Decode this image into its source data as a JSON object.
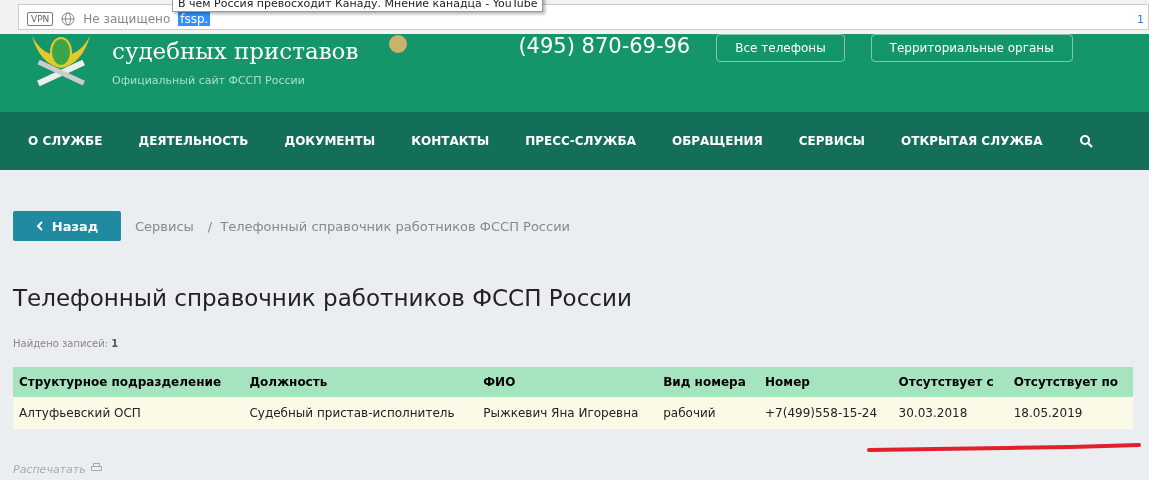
{
  "browser_bar": {
    "vpn_badge": "VPN",
    "security": "Не защищено",
    "url": "fssp.",
    "tooltip": "В чем Россия превосходит Канаду. Мнение канадца - YouTube",
    "counter": "1"
  },
  "header": {
    "title": "судебных приставов",
    "subtitle": "Официальный сайт ФССП России",
    "phone": "(495) 870-69-96",
    "buttons": [
      "Все телефоны",
      "Территориальные органы"
    ]
  },
  "nav": {
    "items": [
      "О СЛУЖБЕ",
      "ДЕЯТЕЛЬНОСТЬ",
      "ДОКУМЕНТЫ",
      "КОНТАКТЫ",
      "ПРЕСС-СЛУЖБА",
      "ОБРАЩЕНИЯ",
      "СЕРВИСЫ",
      "ОТКРЫТАЯ СЛУЖБА"
    ]
  },
  "back_button": "Назад",
  "breadcrumbs": [
    "Сервисы",
    "Телефонный справочник работников ФССП России"
  ],
  "breadcrumb_separator": "/",
  "page_title": "Телефонный справочник работников ФССП России",
  "found": {
    "label": "Найдено записей:",
    "count": "1"
  },
  "table": {
    "columns": [
      "Структурное подразделение",
      "Должность",
      "ФИО",
      "Вид номера",
      "Номер",
      "Отсутствует с",
      "Отсутствует по"
    ],
    "rows": [
      [
        "Алтуфьевский ОСП",
        "Судебный пристав-исполнитель",
        "Рыжкевич Яна Игоревна",
        "рабочий",
        "+7(499)558-15-24",
        "30.03.2018",
        "18.05.2019"
      ]
    ]
  },
  "print_link": "Распечатать"
}
